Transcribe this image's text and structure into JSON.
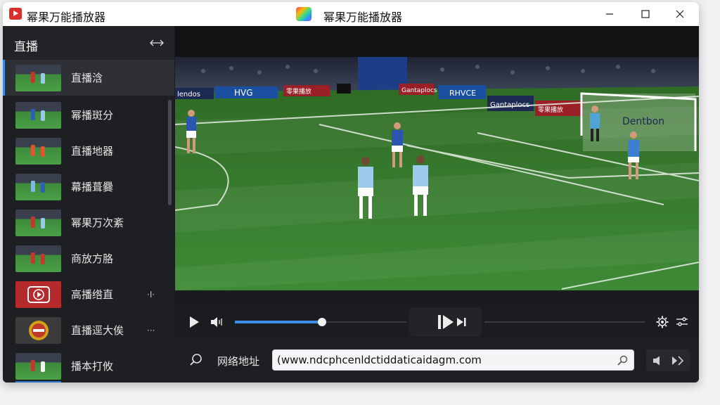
{
  "window": {
    "title": "幂果万能播放器",
    "center_title": "幂果万能播放器"
  },
  "sidebar": {
    "title": "直播",
    "channels": [
      {
        "label": "直播浛",
        "thumb": "football",
        "active": true,
        "extra": ""
      },
      {
        "label": "幂播斑分",
        "thumb": "football",
        "active": false,
        "extra": ""
      },
      {
        "label": "直播地器",
        "thumb": "football",
        "active": false,
        "extra": ""
      },
      {
        "label": "幕播葺爨",
        "thumb": "football",
        "active": false,
        "extra": ""
      },
      {
        "label": "幂果万次紊",
        "thumb": "football",
        "active": false,
        "extra": ""
      },
      {
        "label": "商放方胳",
        "thumb": "football",
        "active": false,
        "extra": ""
      },
      {
        "label": "高播绺直",
        "thumb": "play-logo",
        "active": false,
        "extra": "·I·"
      },
      {
        "label": "直播逕大俟",
        "thumb": "badge-logo",
        "active": false,
        "extra": "···"
      },
      {
        "label": "播本打攸",
        "thumb": "football",
        "active": false,
        "extra": ""
      }
    ]
  },
  "video": {
    "banners": [
      "lendos",
      "HVG",
      "零果播放",
      "RHVCE",
      "Gantaplocs",
      "零果播放",
      "Dentbon"
    ]
  },
  "player": {
    "progress": 0.5
  },
  "address": {
    "label": "网络地址",
    "url": "(www.ndcphcenldctiddaticaidagm.com"
  },
  "colors": {
    "accent": "#3a8ee6",
    "pitch": "#3f8a36",
    "title_bg": "#ffffff",
    "panel_bg": "#1e1f22"
  }
}
